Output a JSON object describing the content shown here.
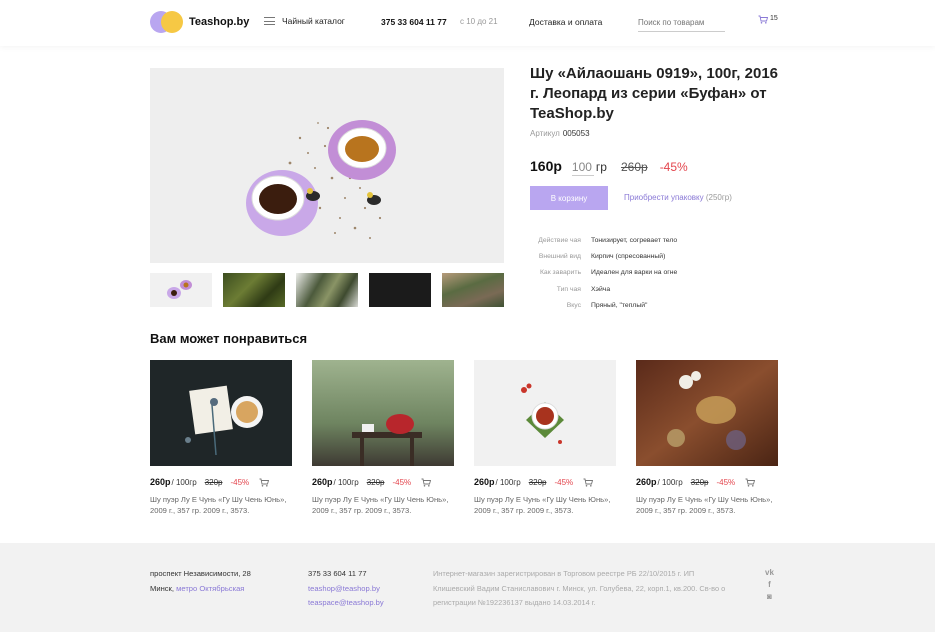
{
  "header": {
    "logo_text": "Teashop.by",
    "catalog_label": "Чайный каталог",
    "phone": "375 33 604 11 77",
    "hours": "с 10 до 21",
    "delivery_label": "Доставка и оплата",
    "search_placeholder": "Поиск по товарам",
    "cart_count": "15"
  },
  "product": {
    "title": "Шу «Айлаошань 0919», 100г, 2016 г. Леопард из серии «Буфан» от TeaShop.by",
    "sku_label": "Артикул",
    "sku": "005053",
    "price": "160р",
    "quantity": "100",
    "unit": "гр",
    "old_price": "260р",
    "discount": "-45%",
    "add_to_cart_label": "В корзину",
    "buy_pack_label": "Приобрести упаковку",
    "buy_pack_weight": "(250гр)",
    "attributes": [
      {
        "key": "Действие чая",
        "value": "Тонизирует, согревает тело"
      },
      {
        "key": "Внешний вид",
        "value": "Кирпич (спресованный)"
      },
      {
        "key": "Как заварить",
        "value": "Идеален для варки на огне"
      },
      {
        "key": "Тип чая",
        "value": "Хэйча"
      },
      {
        "key": "Вкус",
        "value": "Пряный, \"теплый\""
      }
    ]
  },
  "recommendations": {
    "title": "Вам может понравиться",
    "items": [
      {
        "price": "260р",
        "unit": "/ 100гр",
        "old_price": "320р",
        "discount": "-45%",
        "name": "Шу пуэр Лу Е Чунь «Гу Шу Чень Юнь», 2009 г., 357 гр. 2009 г., 3573."
      },
      {
        "price": "260р",
        "unit": "/ 100гр",
        "old_price": "320р",
        "discount": "-45%",
        "name": "Шу пуэр Лу Е Чунь «Гу Шу Чень Юнь», 2009 г., 357 гр. 2009 г., 3573."
      },
      {
        "price": "260р",
        "unit": "/ 100гр",
        "old_price": "320р",
        "discount": "-45%",
        "name": "Шу пуэр Лу Е Чунь «Гу Шу Чень Юнь», 2009 г., 357 гр. 2009 г., 3573."
      },
      {
        "price": "260р",
        "unit": "/ 100гр",
        "old_price": "320р",
        "discount": "-45%",
        "name": "Шу пуэр Лу Е Чунь «Гу Шу Чень Юнь», 2009 г., 357 гр. 2009 г., 3573."
      }
    ]
  },
  "footer": {
    "address_line1": "проспект Независимости, 28",
    "address_city": "Минск,",
    "metro": "метро Октябрьская",
    "phone": "375 33 604 11 77",
    "email1": "teashop@teashop.by",
    "email2": "teaspace@teashop.by",
    "legal": "Интернет-магазин зарегистрирован в Торговом реестре РБ 22/10/2015 г. ИП Клишевский Вадим Станиславович г. Минск, ул. Голубева, 22, корп.1, кв.200. Св-во о регистрации №192236137 выдано 14.03.2014 г.",
    "social": [
      "vk-icon",
      "facebook-icon",
      "instagram-icon"
    ]
  },
  "colors": {
    "accent": "#b9a6f0",
    "logo_yellow": "#f6c844",
    "discount_red": "#e3454d",
    "link_purple": "#8a79d6",
    "footer_bg": "#f2f2f2"
  }
}
